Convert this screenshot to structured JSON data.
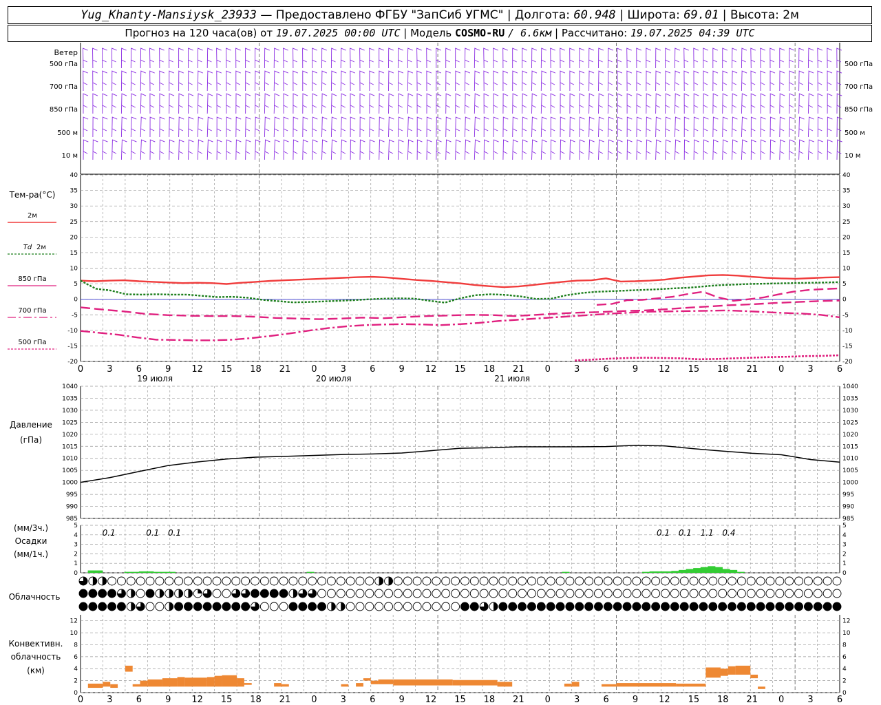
{
  "header": {
    "station": "Yug_Khanty-Mansiysk_23933",
    "provider": "— Предоставлено ФГБУ \"ЗапСиб УГМС\"",
    "lon_label": "Долгота:",
    "lon": "60.948",
    "lat_label": "Широта:",
    "lat": "69.01",
    "height_label": "Высота:",
    "height": "2м",
    "forecast_label": "Прогноз на 120 часа(ов) от",
    "forecast_from": "19.07.2025 00:00 UTC",
    "model_label": "Модель",
    "model": "COSMO-RU",
    "resolution": "/ 6.6км",
    "computed_label": "Рассчитано:",
    "computed": "19.07.2025 04:39 UTC"
  },
  "labels": {
    "wind": "Ветер",
    "wind_levels": [
      "500 гПа",
      "700 гПа",
      "850 гПа",
      "500 м",
      "10 м"
    ],
    "temp_title": "Тем-ра(°С)",
    "legend_2m": "2м",
    "legend_td": "Td",
    "legend_td_suffix": "2м",
    "legend_850": "850 гПа",
    "legend_700": "700 гПа",
    "legend_500": "500 гПа",
    "pressure_title": "Давление",
    "pressure_unit": "(гПа)",
    "precip_unit3": "(мм/3ч.)",
    "precip_title": "Осадки",
    "precip_unit1": "(мм/1ч.)",
    "cloud_title": "Облачность",
    "conv_title1": "Конвективн.",
    "conv_title2": "облачность",
    "conv_unit": "(км)",
    "dates": [
      "19 июля",
      "20 июля",
      "21 июля"
    ]
  },
  "colors": {
    "wind": "#8a2be2",
    "t2m": "#f03c3c",
    "td": "#1a7d1a",
    "levels": "#e0207f",
    "pressure": "#000000",
    "precip": "#33cc33",
    "conv": "#ee8833",
    "zero_line": "#3333cc",
    "grid": "#999999"
  },
  "chart_data": [
    {
      "type": "line",
      "name": "temperature",
      "x_hours_ticks": [
        "0",
        "3",
        "6",
        "9",
        "12",
        "15",
        "18",
        "21",
        "0",
        "3",
        "6",
        "9",
        "12",
        "15",
        "18",
        "21",
        "0",
        "3",
        "6",
        "9",
        "12",
        "15",
        "18",
        "21",
        "0",
        "3",
        "6"
      ],
      "ylim": [
        -20,
        40
      ],
      "yticks": [
        "-20",
        "-15",
        "-10",
        "-5",
        "0",
        "5",
        "10",
        "15",
        "20",
        "25",
        "30",
        "35",
        "40"
      ],
      "x_step_hours": 3,
      "series": [
        {
          "name": "2м",
          "values": [
            6,
            5.8,
            6,
            6.1,
            5.8,
            5.6,
            5.4,
            5.2,
            5.3,
            5.2,
            4.9,
            5.3,
            5.6,
            5.9,
            6.1,
            6.3,
            6.5,
            6.7,
            6.9,
            7.1,
            7.2,
            7.0,
            6.6,
            6.2,
            5.9,
            5.5,
            5.1,
            4.6,
            4.2,
            3.9,
            4.1,
            4.6,
            5.1,
            5.6,
            6.0,
            6.1,
            6.7,
            5.7,
            5.8,
            6.0,
            6.3,
            6.9,
            7.3,
            7.7,
            7.8,
            7.6,
            7.2,
            6.9,
            6.7,
            6.6,
            6.8,
            7.0,
            7.1
          ]
        },
        {
          "name": "Td 2м",
          "values": [
            6,
            3.4,
            2.8,
            1.6,
            1.5,
            1.6,
            1.5,
            1.5,
            1.1,
            0.7,
            0.8,
            0.5,
            -0.2,
            -0.6,
            -1.0,
            -0.9,
            -0.7,
            -0.5,
            -0.3,
            0.0,
            0.2,
            0.3,
            0.2,
            -0.5,
            -1.1,
            0.3,
            1.3,
            1.6,
            1.4,
            0.9,
            0.1,
            0.2,
            1.3,
            2.0,
            2.4,
            2.6,
            2.8,
            3.0,
            3.2,
            3.5,
            3.7,
            4.1,
            4.5,
            4.7,
            4.9,
            5.0,
            5.1,
            5.2,
            5.3,
            5.4,
            5.5
          ]
        },
        {
          "name": "850 гПа",
          "values": [
            null,
            null,
            null,
            null,
            null,
            null,
            null,
            null,
            null,
            null,
            null,
            null,
            null,
            null,
            null,
            null,
            null,
            null,
            null,
            null,
            null,
            null,
            null,
            null,
            null,
            null,
            null,
            null,
            null,
            null,
            null,
            null,
            null,
            null,
            -1.8,
            -1.5,
            -0.3,
            -0.2,
            0.3,
            0.8,
            1.7,
            2.4,
            0.6,
            -0.5,
            0.0,
            0.6,
            1.6,
            2.5,
            3.0,
            3.3,
            3.5
          ]
        },
        {
          "name": "700 гПа",
          "values": [
            -2.6,
            -3.3,
            -3.9,
            -4.7,
            -5.1,
            -5.3,
            -5.4,
            -5.4,
            -5.6,
            -6.0,
            -6.2,
            -6.4,
            -6.2,
            -5.9,
            -6.1,
            -5.7,
            -5.4,
            -5.2,
            -5.0,
            -5.1,
            -5.4,
            -5.0,
            -4.6,
            -4.3,
            -4.1,
            -3.8,
            -3.6,
            -3.2,
            -2.7,
            -2.3,
            -1.9,
            -1.6,
            -1.2,
            -0.9,
            -0.6,
            -0.4
          ]
        },
        {
          "name": "700 гПа (нижн.)",
          "values": [
            -10.2,
            -10.8,
            -11.4,
            -12.3,
            -13.0,
            -13.1,
            -13.2,
            -13.2,
            -13.0,
            -12.5,
            -11.8,
            -11.0,
            -10.1,
            -9.3,
            -8.7,
            -8.3,
            -8.1,
            -8.0,
            -8.1,
            -8.3,
            -8.0,
            -7.6,
            -7.0,
            -6.6,
            -6.2,
            -5.8,
            -5.4,
            -5.0,
            -4.6,
            -4.3,
            -4.0,
            -3.9,
            -3.8,
            -3.7,
            -3.6,
            -3.8,
            -4.1,
            -4.4,
            -4.6,
            -5.0,
            -5.8
          ]
        },
        {
          "name": "500 гПа",
          "values": [
            null,
            null,
            null,
            null,
            null,
            null,
            null,
            null,
            null,
            null,
            null,
            null,
            null,
            null,
            null,
            null,
            null,
            null,
            null,
            null,
            null,
            null,
            null,
            null,
            null,
            null,
            null,
            null,
            -19.7,
            -19.4,
            -19.1,
            -18.9,
            -18.8,
            -18.9,
            -19.0,
            -19.3,
            -19.2,
            -19.0,
            -18.8,
            -18.6,
            -18.5,
            -18.3,
            -18.2,
            -18.0
          ]
        }
      ]
    },
    {
      "type": "line",
      "name": "pressure",
      "ylim": [
        985,
        1040
      ],
      "yticks": [
        "985",
        "990",
        "995",
        "1000",
        "1005",
        "1010",
        "1015",
        "1020",
        "1025",
        "1030",
        "1035",
        "1040"
      ],
      "x_step_hours": 6,
      "series": [
        {
          "name": "Давление",
          "values": [
            1000,
            1002,
            1004.5,
            1007,
            1008.5,
            1009.7,
            1010.5,
            1010.8,
            1011.2,
            1011.6,
            1011.8,
            1012.2,
            1013.2,
            1014.2,
            1014.4,
            1014.8,
            1014.8,
            1014.8,
            1014.9,
            1015.4,
            1015.2,
            1014.0,
            1013.0,
            1012.1,
            1011.5,
            1009.5,
            1008.4
          ]
        }
      ]
    },
    {
      "type": "bar",
      "name": "precipitation",
      "ylim": [
        0,
        5
      ],
      "yticks": [
        "0",
        "1",
        "2",
        "3",
        "4",
        "5"
      ],
      "labels_3h": [
        {
          "hour": 2,
          "text": "0.1"
        },
        {
          "hour": 8,
          "text": "0.1"
        },
        {
          "hour": 11,
          "text": "0.1"
        },
        {
          "hour": 78,
          "text": "0.1"
        },
        {
          "hour": 81,
          "text": "0.1"
        },
        {
          "hour": 84,
          "text": "1.1"
        },
        {
          "hour": 87,
          "text": "0.4"
        }
      ],
      "values_1h": [
        {
          "hour": 1,
          "v": 0.25
        },
        {
          "hour": 2,
          "v": 0.25
        },
        {
          "hour": 6,
          "v": 0.1
        },
        {
          "hour": 7,
          "v": 0.1
        },
        {
          "hour": 8,
          "v": 0.15
        },
        {
          "hour": 9,
          "v": 0.15
        },
        {
          "hour": 10,
          "v": 0.1
        },
        {
          "hour": 11,
          "v": 0.1
        },
        {
          "hour": 12,
          "v": 0.1
        },
        {
          "hour": 31,
          "v": 0.1
        },
        {
          "hour": 66,
          "v": 0.1
        },
        {
          "hour": 77,
          "v": 0.1
        },
        {
          "hour": 78,
          "v": 0.15
        },
        {
          "hour": 79,
          "v": 0.15
        },
        {
          "hour": 80,
          "v": 0.15
        },
        {
          "hour": 81,
          "v": 0.2
        },
        {
          "hour": 82,
          "v": 0.3
        },
        {
          "hour": 83,
          "v": 0.4
        },
        {
          "hour": 84,
          "v": 0.5
        },
        {
          "hour": 85,
          "v": 0.6
        },
        {
          "hour": 86,
          "v": 0.7
        },
        {
          "hour": 87,
          "v": 0.6
        },
        {
          "hour": 88,
          "v": 0.4
        },
        {
          "hour": 89,
          "v": 0.3
        },
        {
          "hour": 90,
          "v": 0.1
        }
      ]
    },
    {
      "type": "table",
      "name": "cloudiness",
      "rows": [
        "32200000000000000000000000000002200000000000000000000000000000000000000000000000",
        "44443204222213003344442330000000000000000000000000000000000000000000000000000000",
        "44444230024444444430004444220000000000004432444444444444444444444444444444444444"
      ],
      "note": "0=ясно,1=1/4,2=1/2,3=3/4,4=сплошная"
    },
    {
      "type": "bar",
      "name": "convective cloud",
      "ylim": [
        0,
        13
      ],
      "yticks": [
        "0",
        "2",
        "4",
        "6",
        "8",
        "10",
        "12"
      ],
      "bars": [
        {
          "from": 1,
          "to": 3,
          "base": 0.8,
          "top": 1.5
        },
        {
          "from": 3,
          "to": 4,
          "base": 1.0,
          "top": 1.8
        },
        {
          "from": 4,
          "to": 5,
          "base": 0.8,
          "top": 1.4
        },
        {
          "from": 6,
          "to": 7,
          "base": 3.5,
          "top": 4.5
        },
        {
          "from": 7,
          "to": 8,
          "base": 1.0,
          "top": 1.4
        },
        {
          "from": 8,
          "to": 9,
          "base": 1.0,
          "top": 2.0
        },
        {
          "from": 9,
          "to": 11,
          "base": 1.0,
          "top": 2.2
        },
        {
          "from": 11,
          "to": 13,
          "base": 1.0,
          "top": 2.4
        },
        {
          "from": 13,
          "to": 14,
          "base": 1.0,
          "top": 2.6
        },
        {
          "from": 14,
          "to": 17,
          "base": 1.0,
          "top": 2.5
        },
        {
          "from": 17,
          "to": 18,
          "base": 1.0,
          "top": 2.6
        },
        {
          "from": 18,
          "to": 19,
          "base": 1.0,
          "top": 2.8
        },
        {
          "from": 19,
          "to": 21,
          "base": 1.0,
          "top": 2.9
        },
        {
          "from": 21,
          "to": 22,
          "base": 1.0,
          "top": 2.4
        },
        {
          "from": 22,
          "to": 23,
          "base": 1.3,
          "top": 1.6
        },
        {
          "from": 26,
          "to": 27,
          "base": 1.0,
          "top": 1.6
        },
        {
          "from": 27,
          "to": 28,
          "base": 1.0,
          "top": 1.4
        },
        {
          "from": 35,
          "to": 36,
          "base": 1.0,
          "top": 1.4
        },
        {
          "from": 37,
          "to": 38,
          "base": 1.0,
          "top": 1.6
        },
        {
          "from": 38,
          "to": 39,
          "base": 2.0,
          "top": 2.4
        },
        {
          "from": 39,
          "to": 40,
          "base": 1.4,
          "top": 2.0
        },
        {
          "from": 40,
          "to": 42,
          "base": 1.4,
          "top": 2.2
        },
        {
          "from": 42,
          "to": 50,
          "base": 1.2,
          "top": 2.2
        },
        {
          "from": 50,
          "to": 56,
          "base": 1.2,
          "top": 2.1
        },
        {
          "from": 56,
          "to": 58,
          "base": 1.0,
          "top": 1.8
        },
        {
          "from": 65,
          "to": 66,
          "base": 1.0,
          "top": 1.5
        },
        {
          "from": 66,
          "to": 67,
          "base": 1.0,
          "top": 1.8
        },
        {
          "from": 70,
          "to": 72,
          "base": 1.0,
          "top": 1.4
        },
        {
          "from": 72,
          "to": 80,
          "base": 1.0,
          "top": 1.6
        },
        {
          "from": 80,
          "to": 84,
          "base": 1.0,
          "top": 1.5
        },
        {
          "from": 84,
          "to": 86,
          "base": 2.5,
          "top": 4.2
        },
        {
          "from": 86,
          "to": 87,
          "base": 2.8,
          "top": 4.0
        },
        {
          "from": 87,
          "to": 88,
          "base": 3.0,
          "top": 4.4
        },
        {
          "from": 88,
          "to": 90,
          "base": 3.0,
          "top": 4.5
        },
        {
          "from": 90,
          "to": 91,
          "base": 2.4,
          "top": 3.0
        },
        {
          "from": 91,
          "to": 92,
          "base": 0.6,
          "top": 1.0
        }
      ]
    },
    {
      "type": "scatter",
      "name": "wind barbs",
      "levels": [
        "500 гПа",
        "700 гПа",
        "850 гПа",
        "500 м",
        "10 м"
      ],
      "count_per_level": 80
    }
  ]
}
